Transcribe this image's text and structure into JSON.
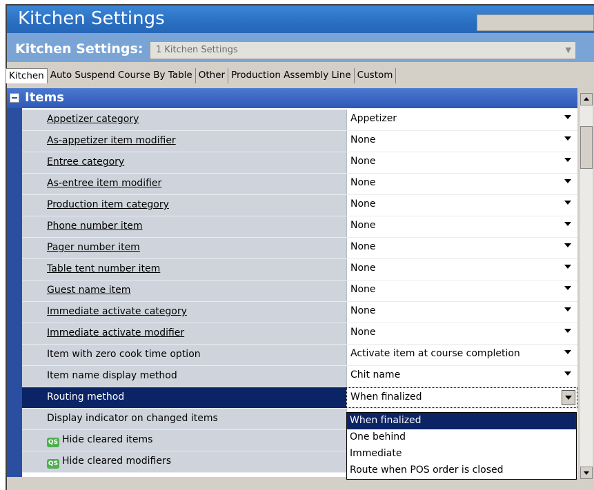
{
  "window": {
    "title": "Kitchen Settings"
  },
  "selector": {
    "label": "Kitchen Settings:",
    "value": "1 Kitchen Settings"
  },
  "tabs": [
    "Kitchen",
    "Auto Suspend Course By Table",
    "Other",
    "Production Assembly Line",
    "Custom"
  ],
  "section": {
    "title": "Items"
  },
  "rows": [
    {
      "label": "Appetizer category",
      "value": "Appetizer"
    },
    {
      "label": "As-appetizer item modifier",
      "value": "None"
    },
    {
      "label": "Entree category",
      "value": "None"
    },
    {
      "label": "As-entree item modifier",
      "value": "None"
    },
    {
      "label": "Production item category",
      "value": "None"
    },
    {
      "label": "Phone number item",
      "value": "None"
    },
    {
      "label": "Pager number item",
      "value": "None"
    },
    {
      "label": "Table tent number item",
      "value": "None"
    },
    {
      "label": "Guest name item",
      "value": "None"
    },
    {
      "label": "Immediate activate category",
      "value": "None"
    },
    {
      "label": "Immediate activate modifier",
      "value": "None"
    },
    {
      "label": "Item with zero cook time option",
      "value": "Activate item at course completion"
    },
    {
      "label": "Item name display method",
      "value": "Chit name"
    },
    {
      "label": "Routing method",
      "value": "When finalized"
    },
    {
      "label": "Display indicator on changed items",
      "value": ""
    },
    {
      "label": "Hide cleared items",
      "value": ""
    },
    {
      "label": "Hide cleared modifiers",
      "value": ""
    }
  ],
  "qs_icon_text": "QS",
  "dropdown": {
    "options": [
      "When finalized",
      "One behind",
      "Immediate",
      "Route when POS order is closed"
    ]
  },
  "icons": {
    "collapse": "minus-box-icon",
    "combo_arrow": "chevron-down-icon"
  }
}
